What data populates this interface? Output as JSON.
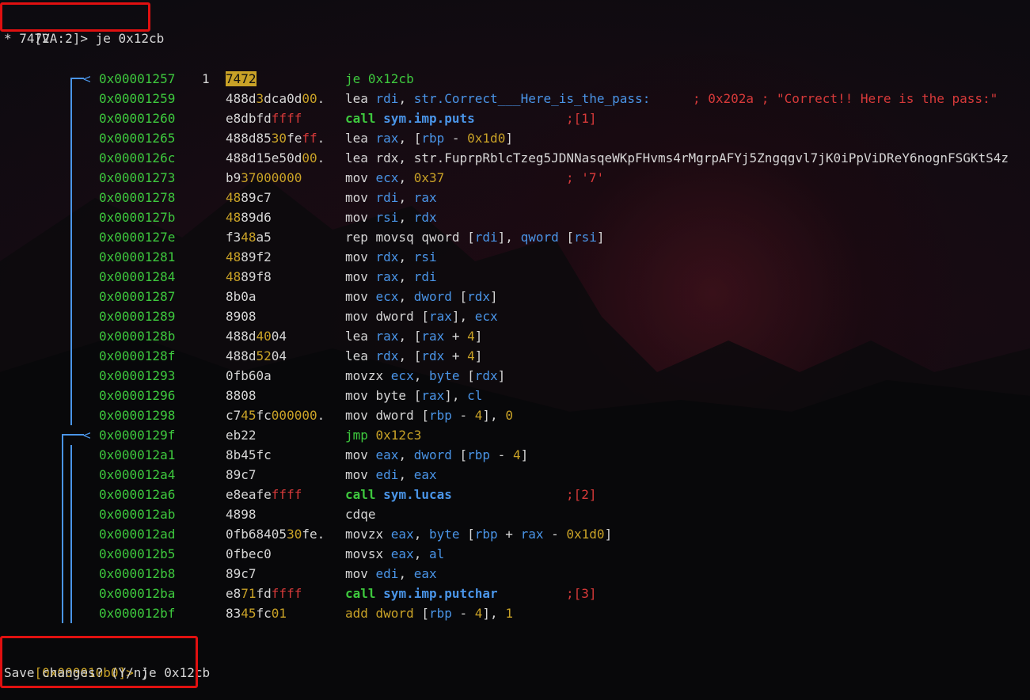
{
  "colors": {
    "address": "#3ec93e",
    "bytes_default": "#d6d6d6",
    "bytes_zero": "#c9a227",
    "bytes_ff": "#d83a3a",
    "register": "#4a95e8",
    "number": "#c9a227",
    "comment": "#d83a3a",
    "jump_arrow": "#4a95e8",
    "highlight_bg": "#c9a227",
    "box_border": "#e01010"
  },
  "top_prompt": {
    "prompt": "[VA:2]>",
    "command": " je 0x12cb"
  },
  "result_line": "* 7472",
  "arrow_glyph": "<",
  "rows": [
    {
      "addr": "0x00001257",
      "index": "1",
      "bytes": [
        {
          "t": "7472",
          "c": "hl"
        }
      ],
      "dis": [
        {
          "t": "je 0x12cb",
          "c": "t-green"
        }
      ],
      "comment": ""
    },
    {
      "addr": "0x00001259",
      "index": "",
      "bytes": [
        {
          "t": "488d",
          "c": "b-white"
        },
        {
          "t": "3",
          "c": "b-yellow"
        },
        {
          "t": "dca0d",
          "c": "b-white"
        },
        {
          "t": "00",
          "c": "b-yellow"
        },
        {
          "t": ".",
          "c": "b-white"
        }
      ],
      "dis": [
        {
          "t": "lea ",
          "c": "t-white"
        },
        {
          "t": "rdi",
          "c": "t-blue"
        },
        {
          "t": ", ",
          "c": "t-white"
        },
        {
          "t": "str.Correct___Here_is_the_pass:",
          "c": "t-blue"
        }
      ],
      "comment": "; 0x202a ; \"Correct!! Here is the pass:\""
    },
    {
      "addr": "0x00001260",
      "index": "",
      "bytes": [
        {
          "t": "e8dbfd",
          "c": "b-white"
        },
        {
          "t": "ffff",
          "c": "b-red"
        }
      ],
      "dis": [
        {
          "t": "call ",
          "c": "t-greenbold"
        },
        {
          "t": "sym.imp.puts",
          "c": "t-bluebold"
        }
      ],
      "comment": ";[1]"
    },
    {
      "addr": "0x00001265",
      "index": "",
      "bytes": [
        {
          "t": "488d85",
          "c": "b-white"
        },
        {
          "t": "30",
          "c": "b-yellow"
        },
        {
          "t": "fe",
          "c": "b-white"
        },
        {
          "t": "ff",
          "c": "b-red"
        },
        {
          "t": ".",
          "c": "b-white"
        }
      ],
      "dis": [
        {
          "t": "lea ",
          "c": "t-white"
        },
        {
          "t": "rax",
          "c": "t-blue"
        },
        {
          "t": ", [",
          "c": "t-white"
        },
        {
          "t": "rbp",
          "c": "t-blue"
        },
        {
          "t": " - ",
          "c": "t-white"
        },
        {
          "t": "0x1d0",
          "c": "t-yellow"
        },
        {
          "t": "]",
          "c": "t-white"
        }
      ],
      "comment": ""
    },
    {
      "addr": "0x0000126c",
      "index": "",
      "bytes": [
        {
          "t": "488d15e50d",
          "c": "b-white"
        },
        {
          "t": "00",
          "c": "b-yellow"
        },
        {
          "t": ".",
          "c": "b-white"
        }
      ],
      "dis": [
        {
          "t": "lea rdx, str.FuprpRblcTzeg5JDNNasqeWKpFHvms4rMgrpAFYj5Zngqgvl7jK0iPpViDReY6nognFSGKtS4z",
          "c": "t-white"
        }
      ],
      "comment": ""
    },
    {
      "addr": "0x00001273",
      "index": "",
      "bytes": [
        {
          "t": "b9",
          "c": "b-white"
        },
        {
          "t": "37000000",
          "c": "b-yellow"
        }
      ],
      "dis": [
        {
          "t": "mov ",
          "c": "t-white"
        },
        {
          "t": "ecx",
          "c": "t-blue"
        },
        {
          "t": ", ",
          "c": "t-white"
        },
        {
          "t": "0x37",
          "c": "t-yellow"
        }
      ],
      "comment": "; '7'"
    },
    {
      "addr": "0x00001278",
      "index": "",
      "bytes": [
        {
          "t": "48",
          "c": "b-yellow"
        },
        {
          "t": "89c7",
          "c": "b-white"
        }
      ],
      "dis": [
        {
          "t": "mov ",
          "c": "t-white"
        },
        {
          "t": "rdi",
          "c": "t-blue"
        },
        {
          "t": ", ",
          "c": "t-white"
        },
        {
          "t": "rax",
          "c": "t-blue"
        }
      ],
      "comment": ""
    },
    {
      "addr": "0x0000127b",
      "index": "",
      "bytes": [
        {
          "t": "48",
          "c": "b-yellow"
        },
        {
          "t": "89d6",
          "c": "b-white"
        }
      ],
      "dis": [
        {
          "t": "mov ",
          "c": "t-white"
        },
        {
          "t": "rsi",
          "c": "t-blue"
        },
        {
          "t": ", ",
          "c": "t-white"
        },
        {
          "t": "rdx",
          "c": "t-blue"
        }
      ],
      "comment": ""
    },
    {
      "addr": "0x0000127e",
      "index": "",
      "bytes": [
        {
          "t": "f3",
          "c": "b-white"
        },
        {
          "t": "48",
          "c": "b-yellow"
        },
        {
          "t": "a5",
          "c": "b-white"
        }
      ],
      "dis": [
        {
          "t": "rep movsq qword [",
          "c": "t-white"
        },
        {
          "t": "rdi",
          "c": "t-blue"
        },
        {
          "t": "], ",
          "c": "t-white"
        },
        {
          "t": "qword",
          "c": "t-blue"
        },
        {
          "t": " [",
          "c": "t-white"
        },
        {
          "t": "rsi",
          "c": "t-blue"
        },
        {
          "t": "]",
          "c": "t-white"
        }
      ],
      "comment": ""
    },
    {
      "addr": "0x00001281",
      "index": "",
      "bytes": [
        {
          "t": "48",
          "c": "b-yellow"
        },
        {
          "t": "89f2",
          "c": "b-white"
        }
      ],
      "dis": [
        {
          "t": "mov ",
          "c": "t-white"
        },
        {
          "t": "rdx",
          "c": "t-blue"
        },
        {
          "t": ", ",
          "c": "t-white"
        },
        {
          "t": "rsi",
          "c": "t-blue"
        }
      ],
      "comment": ""
    },
    {
      "addr": "0x00001284",
      "index": "",
      "bytes": [
        {
          "t": "48",
          "c": "b-yellow"
        },
        {
          "t": "89f8",
          "c": "b-white"
        }
      ],
      "dis": [
        {
          "t": "mov ",
          "c": "t-white"
        },
        {
          "t": "rax",
          "c": "t-blue"
        },
        {
          "t": ", ",
          "c": "t-white"
        },
        {
          "t": "rdi",
          "c": "t-blue"
        }
      ],
      "comment": ""
    },
    {
      "addr": "0x00001287",
      "index": "",
      "bytes": [
        {
          "t": "8b0a",
          "c": "b-white"
        }
      ],
      "dis": [
        {
          "t": "mov ",
          "c": "t-white"
        },
        {
          "t": "ecx",
          "c": "t-blue"
        },
        {
          "t": ", ",
          "c": "t-white"
        },
        {
          "t": "dword",
          "c": "t-blue"
        },
        {
          "t": " [",
          "c": "t-white"
        },
        {
          "t": "rdx",
          "c": "t-blue"
        },
        {
          "t": "]",
          "c": "t-white"
        }
      ],
      "comment": ""
    },
    {
      "addr": "0x00001289",
      "index": "",
      "bytes": [
        {
          "t": "8908",
          "c": "b-white"
        }
      ],
      "dis": [
        {
          "t": "mov dword [",
          "c": "t-white"
        },
        {
          "t": "rax",
          "c": "t-blue"
        },
        {
          "t": "], ",
          "c": "t-white"
        },
        {
          "t": "ecx",
          "c": "t-blue"
        }
      ],
      "comment": ""
    },
    {
      "addr": "0x0000128b",
      "index": "",
      "bytes": [
        {
          "t": "488d",
          "c": "b-white"
        },
        {
          "t": "40",
          "c": "b-yellow"
        },
        {
          "t": "04",
          "c": "b-white"
        }
      ],
      "dis": [
        {
          "t": "lea ",
          "c": "t-white"
        },
        {
          "t": "rax",
          "c": "t-blue"
        },
        {
          "t": ", [",
          "c": "t-white"
        },
        {
          "t": "rax",
          "c": "t-blue"
        },
        {
          "t": " + ",
          "c": "t-white"
        },
        {
          "t": "4",
          "c": "t-yellow"
        },
        {
          "t": "]",
          "c": "t-white"
        }
      ],
      "comment": ""
    },
    {
      "addr": "0x0000128f",
      "index": "",
      "bytes": [
        {
          "t": "488d",
          "c": "b-white"
        },
        {
          "t": "52",
          "c": "b-yellow"
        },
        {
          "t": "04",
          "c": "b-white"
        }
      ],
      "dis": [
        {
          "t": "lea ",
          "c": "t-white"
        },
        {
          "t": "rdx",
          "c": "t-blue"
        },
        {
          "t": ", [",
          "c": "t-white"
        },
        {
          "t": "rdx",
          "c": "t-blue"
        },
        {
          "t": " + ",
          "c": "t-white"
        },
        {
          "t": "4",
          "c": "t-yellow"
        },
        {
          "t": "]",
          "c": "t-white"
        }
      ],
      "comment": ""
    },
    {
      "addr": "0x00001293",
      "index": "",
      "bytes": [
        {
          "t": "0fb60a",
          "c": "b-white"
        }
      ],
      "dis": [
        {
          "t": "movzx ",
          "c": "t-white"
        },
        {
          "t": "ecx",
          "c": "t-blue"
        },
        {
          "t": ", ",
          "c": "t-white"
        },
        {
          "t": "byte",
          "c": "t-blue"
        },
        {
          "t": " [",
          "c": "t-white"
        },
        {
          "t": "rdx",
          "c": "t-blue"
        },
        {
          "t": "]",
          "c": "t-white"
        }
      ],
      "comment": ""
    },
    {
      "addr": "0x00001296",
      "index": "",
      "bytes": [
        {
          "t": "8808",
          "c": "b-white"
        }
      ],
      "dis": [
        {
          "t": "mov byte [",
          "c": "t-white"
        },
        {
          "t": "rax",
          "c": "t-blue"
        },
        {
          "t": "], ",
          "c": "t-white"
        },
        {
          "t": "cl",
          "c": "t-blue"
        }
      ],
      "comment": ""
    },
    {
      "addr": "0x00001298",
      "index": "",
      "bytes": [
        {
          "t": "c7",
          "c": "b-white"
        },
        {
          "t": "45",
          "c": "b-yellow"
        },
        {
          "t": "fc",
          "c": "b-white"
        },
        {
          "t": "000000",
          "c": "b-yellow"
        },
        {
          "t": ".",
          "c": "b-white"
        }
      ],
      "dis": [
        {
          "t": "mov dword [",
          "c": "t-white"
        },
        {
          "t": "rbp",
          "c": "t-blue"
        },
        {
          "t": " - ",
          "c": "t-white"
        },
        {
          "t": "4",
          "c": "t-yellow"
        },
        {
          "t": "], ",
          "c": "t-white"
        },
        {
          "t": "0",
          "c": "t-yellow"
        }
      ],
      "comment": ""
    },
    {
      "addr": "0x0000129f",
      "index": "",
      "bytes": [
        {
          "t": "eb22",
          "c": "b-white"
        }
      ],
      "dis": [
        {
          "t": "jmp ",
          "c": "t-green"
        },
        {
          "t": "0x12c3",
          "c": "t-yellow"
        }
      ],
      "comment": ""
    },
    {
      "addr": "0x000012a1",
      "index": "",
      "bytes": [
        {
          "t": "8b45fc",
          "c": "b-white"
        }
      ],
      "dis": [
        {
          "t": "mov ",
          "c": "t-white"
        },
        {
          "t": "eax",
          "c": "t-blue"
        },
        {
          "t": ", ",
          "c": "t-white"
        },
        {
          "t": "dword",
          "c": "t-blue"
        },
        {
          "t": " [",
          "c": "t-white"
        },
        {
          "t": "rbp",
          "c": "t-blue"
        },
        {
          "t": " - ",
          "c": "t-white"
        },
        {
          "t": "4",
          "c": "t-yellow"
        },
        {
          "t": "]",
          "c": "t-white"
        }
      ],
      "comment": ""
    },
    {
      "addr": "0x000012a4",
      "index": "",
      "bytes": [
        {
          "t": "89c7",
          "c": "b-white"
        }
      ],
      "dis": [
        {
          "t": "mov ",
          "c": "t-white"
        },
        {
          "t": "edi",
          "c": "t-blue"
        },
        {
          "t": ", ",
          "c": "t-white"
        },
        {
          "t": "eax",
          "c": "t-blue"
        }
      ],
      "comment": ""
    },
    {
      "addr": "0x000012a6",
      "index": "",
      "bytes": [
        {
          "t": "e8eafe",
          "c": "b-white"
        },
        {
          "t": "ffff",
          "c": "b-red"
        }
      ],
      "dis": [
        {
          "t": "call ",
          "c": "t-greenbold"
        },
        {
          "t": "sym.lucas",
          "c": "t-bluebold"
        }
      ],
      "comment": ";[2]"
    },
    {
      "addr": "0x000012ab",
      "index": "",
      "bytes": [
        {
          "t": "4898",
          "c": "b-white"
        }
      ],
      "dis": [
        {
          "t": "cdqe",
          "c": "t-white"
        }
      ],
      "comment": ""
    },
    {
      "addr": "0x000012ad",
      "index": "",
      "bytes": [
        {
          "t": "0fb68405",
          "c": "b-white"
        },
        {
          "t": "30",
          "c": "b-yellow"
        },
        {
          "t": "fe.",
          "c": "b-white"
        }
      ],
      "dis": [
        {
          "t": "movzx ",
          "c": "t-white"
        },
        {
          "t": "eax",
          "c": "t-blue"
        },
        {
          "t": ", ",
          "c": "t-white"
        },
        {
          "t": "byte",
          "c": "t-blue"
        },
        {
          "t": " [",
          "c": "t-white"
        },
        {
          "t": "rbp",
          "c": "t-blue"
        },
        {
          "t": " + ",
          "c": "t-white"
        },
        {
          "t": "rax",
          "c": "t-blue"
        },
        {
          "t": " - ",
          "c": "t-white"
        },
        {
          "t": "0x1d0",
          "c": "t-yellow"
        },
        {
          "t": "]",
          "c": "t-white"
        }
      ],
      "comment": ""
    },
    {
      "addr": "0x000012b5",
      "index": "",
      "bytes": [
        {
          "t": "0fbec0",
          "c": "b-white"
        }
      ],
      "dis": [
        {
          "t": "movsx ",
          "c": "t-white"
        },
        {
          "t": "eax",
          "c": "t-blue"
        },
        {
          "t": ", ",
          "c": "t-white"
        },
        {
          "t": "al",
          "c": "t-blue"
        }
      ],
      "comment": ""
    },
    {
      "addr": "0x000012b8",
      "index": "",
      "bytes": [
        {
          "t": "89c7",
          "c": "b-white"
        }
      ],
      "dis": [
        {
          "t": "mov ",
          "c": "t-white"
        },
        {
          "t": "edi",
          "c": "t-blue"
        },
        {
          "t": ", ",
          "c": "t-white"
        },
        {
          "t": "eax",
          "c": "t-blue"
        }
      ],
      "comment": ""
    },
    {
      "addr": "0x000012ba",
      "index": "",
      "bytes": [
        {
          "t": "e8",
          "c": "b-white"
        },
        {
          "t": "71",
          "c": "b-yellow"
        },
        {
          "t": "fd",
          "c": "b-white"
        },
        {
          "t": "ffff",
          "c": "b-red"
        }
      ],
      "dis": [
        {
          "t": "call ",
          "c": "t-greenbold"
        },
        {
          "t": "sym.imp.putchar",
          "c": "t-bluebold"
        }
      ],
      "comment": ";[3]"
    },
    {
      "addr": "0x000012bf",
      "index": "",
      "bytes": [
        {
          "t": "83",
          "c": "b-white"
        },
        {
          "t": "45",
          "c": "b-yellow"
        },
        {
          "t": "fc",
          "c": "b-white"
        },
        {
          "t": "01",
          "c": "b-yellow"
        }
      ],
      "dis": [
        {
          "t": "add ",
          "c": "t-yellow"
        },
        {
          "t": "dword",
          "c": "t-yellow"
        },
        {
          "t": " [",
          "c": "t-white"
        },
        {
          "t": "rbp",
          "c": "t-blue"
        },
        {
          "t": " - ",
          "c": "t-white"
        },
        {
          "t": "4",
          "c": "t-yellow"
        },
        {
          "t": "], ",
          "c": "t-white"
        },
        {
          "t": "1",
          "c": "t-yellow"
        }
      ],
      "comment": ""
    }
  ],
  "bottom_prompt": {
    "prompt": "[0x000010b0]>",
    "command": " je 0x12cb",
    "question": "Save changes? (Y/n)"
  }
}
